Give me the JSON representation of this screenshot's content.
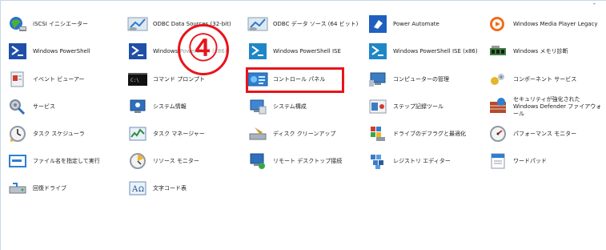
{
  "corner_mark": "-",
  "step_badge": "④",
  "items": [
    {
      "label": "iSCSI イニシエーター",
      "icon": "globe-network-icon"
    },
    {
      "label": "ODBC Data Sources (32-bit)",
      "icon": "odbc-icon"
    },
    {
      "label": "ODBC データ ソース (64 ビット)",
      "icon": "odbc-icon"
    },
    {
      "label": "Power Automate",
      "icon": "power-automate-icon"
    },
    {
      "label": "Windows Media Player Legacy",
      "icon": "media-player-icon"
    },
    {
      "label": "Windows PowerShell",
      "icon": "powershell-icon"
    },
    {
      "label": "Windows PowerShell (x86)",
      "icon": "powershell-icon"
    },
    {
      "label": "Windows PowerShell ISE",
      "icon": "powershell-icon"
    },
    {
      "label": "Windows PowerShell ISE (x86)",
      "icon": "powershell-icon"
    },
    {
      "label": "Windows メモリ診断",
      "icon": "memory-chip-icon"
    },
    {
      "label": "イベント ビューアー",
      "icon": "event-viewer-icon"
    },
    {
      "label": "コマンド プロンプト",
      "icon": "command-prompt-icon"
    },
    {
      "label": "コントロール パネル",
      "icon": "control-panel-icon"
    },
    {
      "label": "コンピューターの管理",
      "icon": "computer-management-icon"
    },
    {
      "label": "コンポーネント サービス",
      "icon": "component-services-icon"
    },
    {
      "label": "サービス",
      "icon": "services-icon"
    },
    {
      "label": "システム情報",
      "icon": "system-info-icon"
    },
    {
      "label": "システム構成",
      "icon": "system-config-icon"
    },
    {
      "label": "ステップ記録ツール",
      "icon": "steps-recorder-icon"
    },
    {
      "label": "セキュリティが強化された Windows Defender ファイアウォール",
      "icon": "firewall-icon"
    },
    {
      "label": "タスク スケジューラ",
      "icon": "task-scheduler-icon"
    },
    {
      "label": "タスク マネージャー",
      "icon": "task-manager-icon"
    },
    {
      "label": "ディスク クリーンアップ",
      "icon": "disk-cleanup-icon"
    },
    {
      "label": "ドライブのデフラグと最適化",
      "icon": "defrag-icon"
    },
    {
      "label": "パフォーマンス モニター",
      "icon": "performance-monitor-icon"
    },
    {
      "label": "ファイル名を指定して実行",
      "icon": "run-icon"
    },
    {
      "label": "リソース モニター",
      "icon": "resource-monitor-icon"
    },
    {
      "label": "リモート デスクトップ接続",
      "icon": "remote-desktop-icon"
    },
    {
      "label": "レジストリ エディター",
      "icon": "registry-editor-icon"
    },
    {
      "label": "ワードパッド",
      "icon": "wordpad-icon"
    },
    {
      "label": "回復ドライブ",
      "icon": "recovery-drive-icon"
    },
    {
      "label": "文字コード表",
      "icon": "character-map-icon"
    }
  ]
}
